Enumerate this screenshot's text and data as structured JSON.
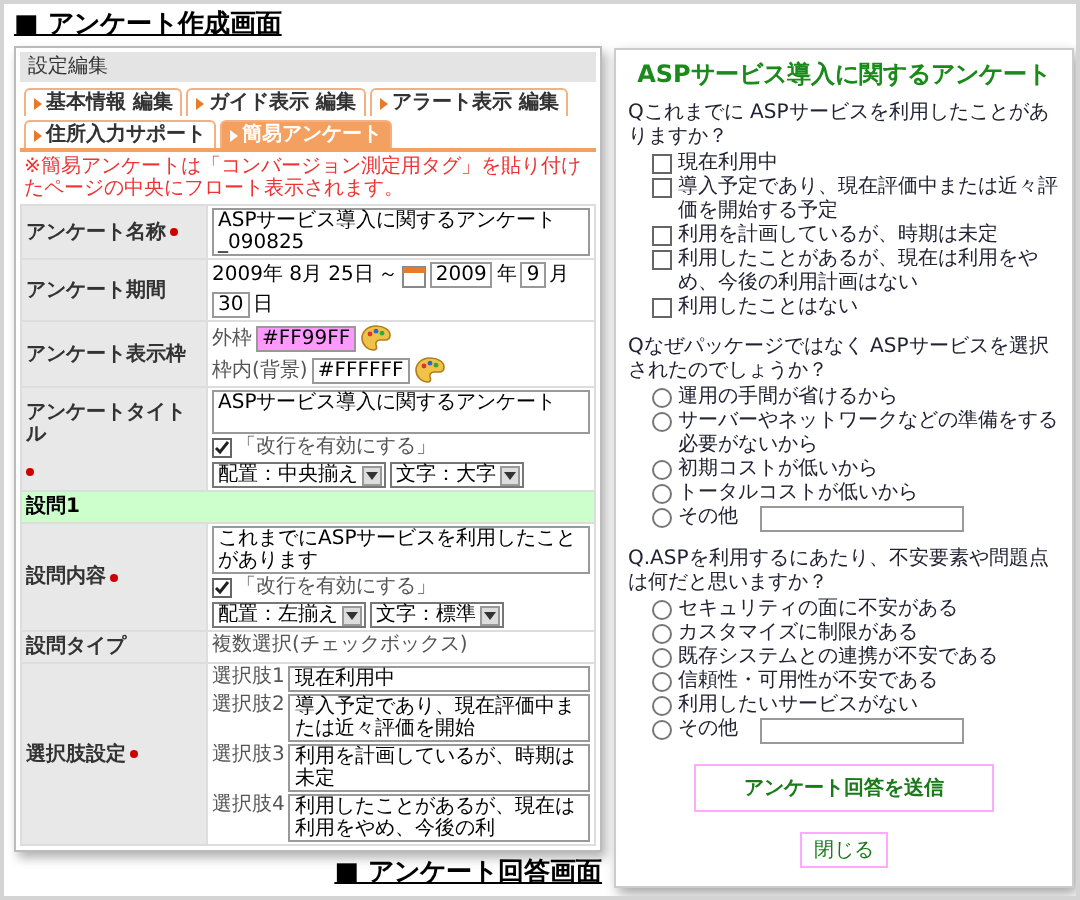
{
  "editor_heading": "■ アンケート作成画面",
  "editor": {
    "header": "設定編集",
    "tabs": [
      {
        "label": "基本情報 編集",
        "selected": false
      },
      {
        "label": "ガイド表示 編集",
        "selected": false
      },
      {
        "label": "アラート表示 編集",
        "selected": false
      },
      {
        "label": "住所入力サポート",
        "selected": false
      },
      {
        "label": "簡易アンケート",
        "selected": true
      }
    ],
    "notice": "※簡易アンケートは「コンバージョン測定用タグ」を貼り付けたページの中央にフロート表示されます。",
    "rows": [
      {
        "kind": "text",
        "label": "アンケート名称",
        "required": true,
        "value": "ASPサービス導入に関するアンケート_090825"
      },
      {
        "kind": "period",
        "label": "アンケート期間",
        "required": false,
        "start": "2009年 8月 25日",
        "separator": "～",
        "end": [
          {
            "value": "2009",
            "unit": "年"
          },
          {
            "value": "9",
            "unit": "月"
          },
          {
            "value": "30",
            "unit": "日"
          }
        ]
      },
      {
        "kind": "colors",
        "label": "アンケート表示枠",
        "required": false,
        "items": [
          {
            "label": "外枠",
            "value": "#FF99FF",
            "color": "#ff99ff"
          },
          {
            "label": "枠内(背景)",
            "value": "#FFFFFF",
            "color": "#ffffff"
          }
        ]
      },
      {
        "kind": "textarea",
        "label": "アンケートタイトル",
        "required": true,
        "value": "ASPサービス導入に関するアンケート",
        "option": {
          "label": "「改行を有効にする」",
          "checked": true
        },
        "selects": [
          "配置：中央揃え",
          "文字：大字"
        ]
      },
      {
        "kind": "section",
        "label": "設問1"
      },
      {
        "kind": "textarea",
        "label": "設問内容",
        "required": true,
        "value": "これまでにASPサービスを利用したことがあります",
        "option": {
          "label": "「改行を有効にする」",
          "checked": true
        },
        "selects": [
          "配置：左揃え",
          "文字：標準"
        ]
      },
      {
        "kind": "static",
        "label": "設問タイプ",
        "required": false,
        "value": "複数選択(チェックボックス)"
      },
      {
        "kind": "choices",
        "label": "選択肢設定",
        "required": true,
        "items": [
          {
            "label": "選択肢1",
            "value": "現在利用中"
          },
          {
            "label": "選択肢2",
            "value": "導入予定であり、現在評価中または近々評価を開始"
          },
          {
            "label": "選択肢3",
            "value": "利用を計画しているが、時期は未定"
          },
          {
            "label": "選択肢4",
            "value": "利用したことがあるが、現在は利用をやめ、今後の利"
          }
        ]
      }
    ]
  },
  "answer_heading": "■ アンケート回答画面",
  "preview": {
    "title": "ASPサービス導入に関するアンケート",
    "questions": [
      {
        "kind": "checkbox",
        "text": "Qこれまでに ASPサービスを利用したことがありますか？",
        "options": [
          {
            "kind": "plain",
            "label": "現在利用中",
            "checked": false
          },
          {
            "kind": "plain",
            "label": "導入予定であり、現在評価中または近々評価を開始する予定",
            "checked": false
          },
          {
            "kind": "plain",
            "label": "利用を計画しているが、時期は未定",
            "checked": false
          },
          {
            "kind": "plain",
            "label": "利用したことがあるが、現在は利用をやめ、今後の利用計画はない",
            "checked": false
          },
          {
            "kind": "plain",
            "label": "利用したことはない",
            "checked": false
          }
        ]
      },
      {
        "kind": "radio",
        "text": "Qなぜパッケージではなく ASPサービスを選択されたのでしょうか？",
        "options": [
          {
            "kind": "plain",
            "label": "運用の手間が省けるから",
            "selected": false
          },
          {
            "kind": "plain",
            "label": "サーバーやネットワークなどの準備をする必要がないから",
            "selected": false
          },
          {
            "kind": "plain",
            "label": "初期コストが低いから",
            "selected": false
          },
          {
            "kind": "plain",
            "label": "トータルコストが低いから",
            "selected": false
          },
          {
            "kind": "other",
            "label": "その他",
            "selected": false
          }
        ]
      },
      {
        "kind": "radio",
        "text": "Q.ASPを利用するにあたり、不安要素や問題点は何だと思いますか？",
        "options": [
          {
            "kind": "plain",
            "label": "セキュリティの面に不安がある",
            "selected": false
          },
          {
            "kind": "plain",
            "label": "カスタマイズに制限がある",
            "selected": false
          },
          {
            "kind": "plain",
            "label": "既存システムとの連携が不安である",
            "selected": false
          },
          {
            "kind": "plain",
            "label": "信頼性・可用性が不安である",
            "selected": false
          },
          {
            "kind": "plain",
            "label": "利用したいサービスがない",
            "selected": false
          },
          {
            "kind": "other",
            "label": "その他",
            "selected": false
          }
        ]
      }
    ],
    "submit": "アンケート回答を送信",
    "close": "閉じる"
  }
}
